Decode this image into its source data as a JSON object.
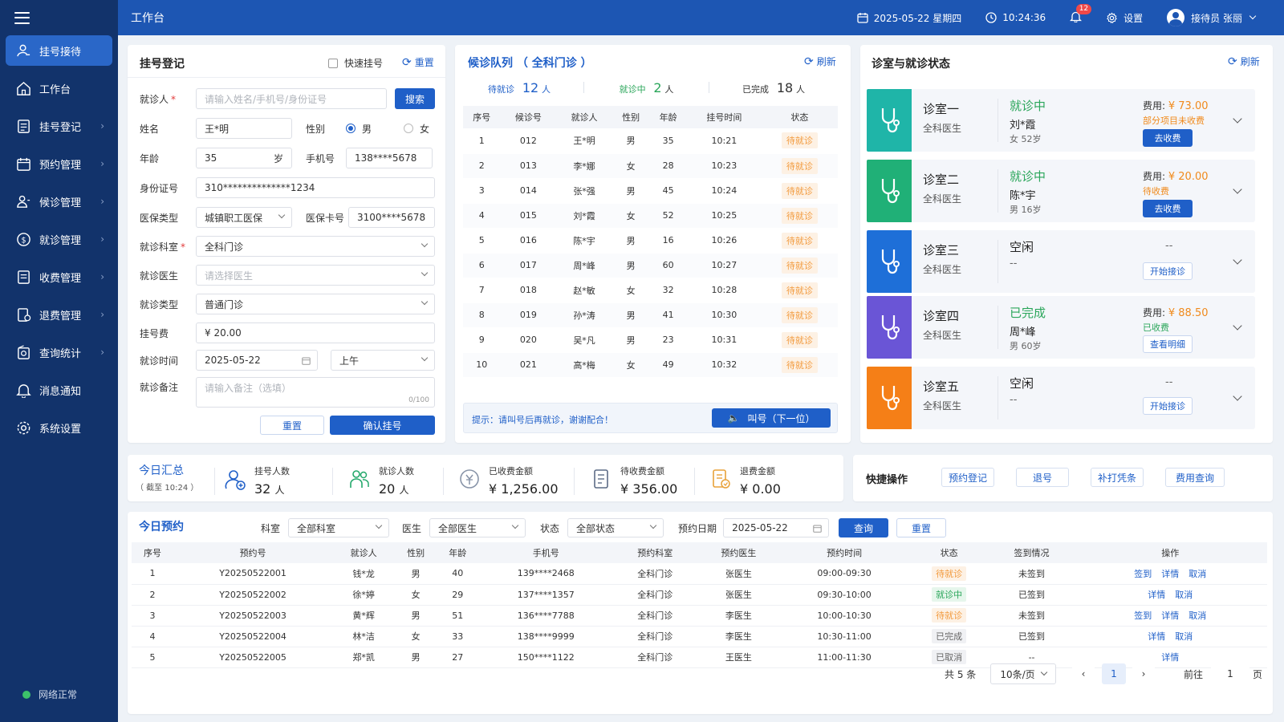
{
  "sidebar": {
    "items": [
      {
        "label": "挂号接待",
        "icon": "user-receive-icon",
        "active": true
      },
      {
        "label": "工作台",
        "icon": "home-icon"
      },
      {
        "label": "挂号登记",
        "icon": "register-icon"
      },
      {
        "label": "预约管理",
        "icon": "calendar-icon"
      },
      {
        "label": "候诊管理",
        "icon": "queue-icon"
      },
      {
        "label": "就诊管理",
        "icon": "visit-icon"
      },
      {
        "label": "收费管理",
        "icon": "billing-icon"
      },
      {
        "label": "退费管理",
        "icon": "refund-icon"
      },
      {
        "label": "查询统计",
        "icon": "stats-icon"
      },
      {
        "label": "消息通知",
        "icon": "bell-icon"
      },
      {
        "label": "系统设置",
        "icon": "gear-icon"
      }
    ],
    "network_status": "网络正常"
  },
  "topbar": {
    "title": "工作台",
    "date": "2025-05-22  星期四",
    "time": "10:24:36",
    "notification_count": "12",
    "settings_label": "设置",
    "user_label": "接待员 张丽"
  },
  "registration": {
    "title": "挂号登记",
    "quick_label": "快速挂号",
    "reset_label": "重置",
    "patient_label": "就诊人",
    "patient_placeholder": "请输入姓名/手机号/身份证号",
    "search_label": "搜索",
    "name_label": "姓名",
    "name_value": "王*明",
    "gender_label": "性别",
    "gender_male": "男",
    "gender_female": "女",
    "age_label": "年龄",
    "age_value": "35",
    "age_unit": "岁",
    "phone_label": "手机号",
    "phone_value": "138****5678",
    "id_label": "身份证号",
    "id_value": "310**************1234",
    "insurance_type_label": "医保类型",
    "insurance_type_value": "城镇职工医保",
    "insurance_card_label": "医保卡号",
    "insurance_card_value": "3100****5678",
    "dept_label": "就诊科室",
    "dept_value": "全科门诊",
    "doctor_label": "就诊医生",
    "doctor_placeholder": "请选择医生",
    "visit_type_label": "就诊类型",
    "visit_type_value": "普通门诊",
    "fee_label": "挂号费",
    "fee_value": "¥  20.00",
    "time_label": "就诊时间",
    "date_value": "2025-05-22",
    "period_value": "上午",
    "note_label": "就诊备注",
    "note_placeholder": "请输入备注（选填）",
    "note_counter": "0/100",
    "btn_reset": "重置",
    "btn_confirm": "确认挂号"
  },
  "queue": {
    "title": "候诊队列 （ 全科门诊 ）",
    "refresh_label": "刷新",
    "waiting_label": "待就诊",
    "waiting_count": "12",
    "in_progress_label": "就诊中",
    "in_progress_count": "2",
    "done_label": "已完成",
    "done_count": "18",
    "count_unit": "人",
    "headers": [
      "序号",
      "候诊号",
      "就诊人",
      "性别",
      "年龄",
      "挂号时间",
      "状态"
    ],
    "rows": [
      {
        "seq": "1",
        "no": "012",
        "name": "王*明",
        "gender": "男",
        "age": "35",
        "time": "10:21",
        "status": "待就诊"
      },
      {
        "seq": "2",
        "no": "013",
        "name": "李*娜",
        "gender": "女",
        "age": "28",
        "time": "10:23",
        "status": "待就诊"
      },
      {
        "seq": "3",
        "no": "014",
        "name": "张*强",
        "gender": "男",
        "age": "45",
        "time": "10:24",
        "status": "待就诊"
      },
      {
        "seq": "4",
        "no": "015",
        "name": "刘*霞",
        "gender": "女",
        "age": "52",
        "time": "10:25",
        "status": "待就诊"
      },
      {
        "seq": "5",
        "no": "016",
        "name": "陈*宇",
        "gender": "男",
        "age": "16",
        "time": "10:26",
        "status": "待就诊"
      },
      {
        "seq": "6",
        "no": "017",
        "name": "周*峰",
        "gender": "男",
        "age": "60",
        "time": "10:27",
        "status": "待就诊"
      },
      {
        "seq": "7",
        "no": "018",
        "name": "赵*敏",
        "gender": "女",
        "age": "32",
        "time": "10:28",
        "status": "待就诊"
      },
      {
        "seq": "8",
        "no": "019",
        "name": "孙*涛",
        "gender": "男",
        "age": "41",
        "time": "10:30",
        "status": "待就诊"
      },
      {
        "seq": "9",
        "no": "020",
        "name": "吴*凡",
        "gender": "男",
        "age": "23",
        "time": "10:31",
        "status": "待就诊"
      },
      {
        "seq": "10",
        "no": "021",
        "name": "高*梅",
        "gender": "女",
        "age": "49",
        "time": "10:32",
        "status": "待就诊"
      }
    ],
    "tip": "提示：请叫号后再就诊，谢谢配合！",
    "call_label": "叫号（下一位）"
  },
  "rooms": {
    "title": "诊室与就诊状态",
    "refresh_label": "刷新",
    "items": [
      {
        "name": "诊室一",
        "doctor": "全科医生",
        "color": "#1fb5a8",
        "status": "就诊中",
        "status_color": "#2aa65a",
        "patient": "刘*霞",
        "sub": "女  52岁",
        "fee_label": "费用:",
        "fee": "¥ 73.00",
        "note": "部分项目未收费",
        "note_color": "#f08a1c",
        "btn": "去收费",
        "btn_solid": true
      },
      {
        "name": "诊室二",
        "doctor": "全科医生",
        "color": "#20b077",
        "status": "就诊中",
        "status_color": "#2aa65a",
        "patient": "陈*宇",
        "sub": "男  16岁",
        "fee_label": "费用:",
        "fee": "¥ 20.00",
        "note": "待收费",
        "note_color": "#f08a1c",
        "btn": "去收费",
        "btn_solid": true
      },
      {
        "name": "诊室三",
        "doctor": "全科医生",
        "color": "#1e6fd8",
        "status": "空闲",
        "status_color": "#222",
        "patient": "--",
        "sub": "",
        "fee_label": "",
        "fee": "",
        "note": "--",
        "note_color": "#666",
        "btn": "开始接诊",
        "btn_solid": false
      },
      {
        "name": "诊室四",
        "doctor": "全科医生",
        "color": "#6a55d6",
        "status": "已完成",
        "status_color": "#2aa65a",
        "patient": "周*峰",
        "sub": "男  60岁",
        "fee_label": "费用:",
        "fee": "¥ 88.50",
        "note": "已收费",
        "note_color": "#2aa65a",
        "btn": "查看明细",
        "btn_solid": false
      },
      {
        "name": "诊室五",
        "doctor": "全科医生",
        "color": "#f57f17",
        "status": "空闲",
        "status_color": "#222",
        "patient": "--",
        "sub": "",
        "fee_label": "",
        "fee": "",
        "note": "--",
        "note_color": "#666",
        "btn": "开始接诊",
        "btn_solid": false
      }
    ]
  },
  "summary": {
    "title": "今日汇总",
    "subtitle": "（ 截至 10:24 ）",
    "items": [
      {
        "label": "挂号人数",
        "value": "32",
        "unit": "人",
        "icon": "user-add-icon"
      },
      {
        "label": "就诊人数",
        "value": "20",
        "unit": "人",
        "icon": "patients-icon"
      },
      {
        "label": "已收费金额",
        "value": "¥ 1,256.00",
        "unit": "",
        "icon": "coin-icon"
      },
      {
        "label": "待收费金额",
        "value": "¥ 356.00",
        "unit": "",
        "icon": "bill-icon"
      },
      {
        "label": "退费金额",
        "value": "¥ 0.00",
        "unit": "",
        "icon": "refund-doc-icon"
      }
    ]
  },
  "quick_ops": {
    "title": "快捷操作",
    "buttons": [
      "预约登记",
      "退号",
      "补打凭条",
      "费用查询"
    ]
  },
  "appointments": {
    "title": "今日预约",
    "filters": {
      "dept_label": "科室",
      "dept_value": "全部科室",
      "doctor_label": "医生",
      "doctor_value": "全部医生",
      "status_label": "状态",
      "status_value": "全部状态",
      "date_label": "预约日期",
      "date_value": "2025-05-22",
      "query_label": "查询",
      "reset_label": "重置"
    },
    "headers": [
      "序号",
      "预约号",
      "就诊人",
      "性别",
      "年龄",
      "手机号",
      "预约科室",
      "预约医生",
      "预约时间",
      "状态",
      "签到情况",
      "操作"
    ],
    "rows": [
      {
        "seq": "1",
        "no": "Y20250522001",
        "name": "钱*龙",
        "gender": "男",
        "age": "40",
        "phone": "139****2468",
        "dept": "全科门诊",
        "doctor": "张医生",
        "time": "09:00-09:30",
        "status": "待就诊",
        "status_type": "wait",
        "sign": "未签到",
        "sign_type": "no",
        "ops": [
          "签到",
          "详情",
          "取消"
        ]
      },
      {
        "seq": "2",
        "no": "Y20250522002",
        "name": "徐*婷",
        "gender": "女",
        "age": "29",
        "phone": "137****1357",
        "dept": "全科门诊",
        "doctor": "张医生",
        "time": "09:30-10:00",
        "status": "就诊中",
        "status_type": "in",
        "sign": "已签到",
        "sign_type": "yes",
        "ops": [
          "详情",
          "取消"
        ]
      },
      {
        "seq": "3",
        "no": "Y20250522003",
        "name": "黄*辉",
        "gender": "男",
        "age": "51",
        "phone": "136****7788",
        "dept": "全科门诊",
        "doctor": "李医生",
        "time": "10:00-10:30",
        "status": "待就诊",
        "status_type": "wait",
        "sign": "未签到",
        "sign_type": "no",
        "ops": [
          "签到",
          "详情",
          "取消"
        ]
      },
      {
        "seq": "4",
        "no": "Y20250522004",
        "name": "林*洁",
        "gender": "女",
        "age": "33",
        "phone": "138****9999",
        "dept": "全科门诊",
        "doctor": "李医生",
        "time": "10:30-11:00",
        "status": "已完成",
        "status_type": "done",
        "sign": "已签到",
        "sign_type": "yes",
        "ops": [
          "详情",
          "取消"
        ]
      },
      {
        "seq": "5",
        "no": "Y20250522005",
        "name": "郑*凯",
        "gender": "男",
        "age": "27",
        "phone": "150****1122",
        "dept": "全科门诊",
        "doctor": "王医生",
        "time": "11:00-11:30",
        "status": "已取消",
        "status_type": "done",
        "sign": "--",
        "sign_type": "none",
        "ops": [
          "详情"
        ]
      }
    ],
    "pager": {
      "total": "共 5 条",
      "page_size": "10条/页",
      "current": "1",
      "goto_label": "前往",
      "goto_value": "1",
      "page_unit": "页"
    }
  },
  "colors": {
    "primary": "#1f5fc8",
    "sidebar": "#12336b",
    "topbar": "#1d56b3",
    "orange": "#f08a1c",
    "green": "#2aa65a"
  }
}
